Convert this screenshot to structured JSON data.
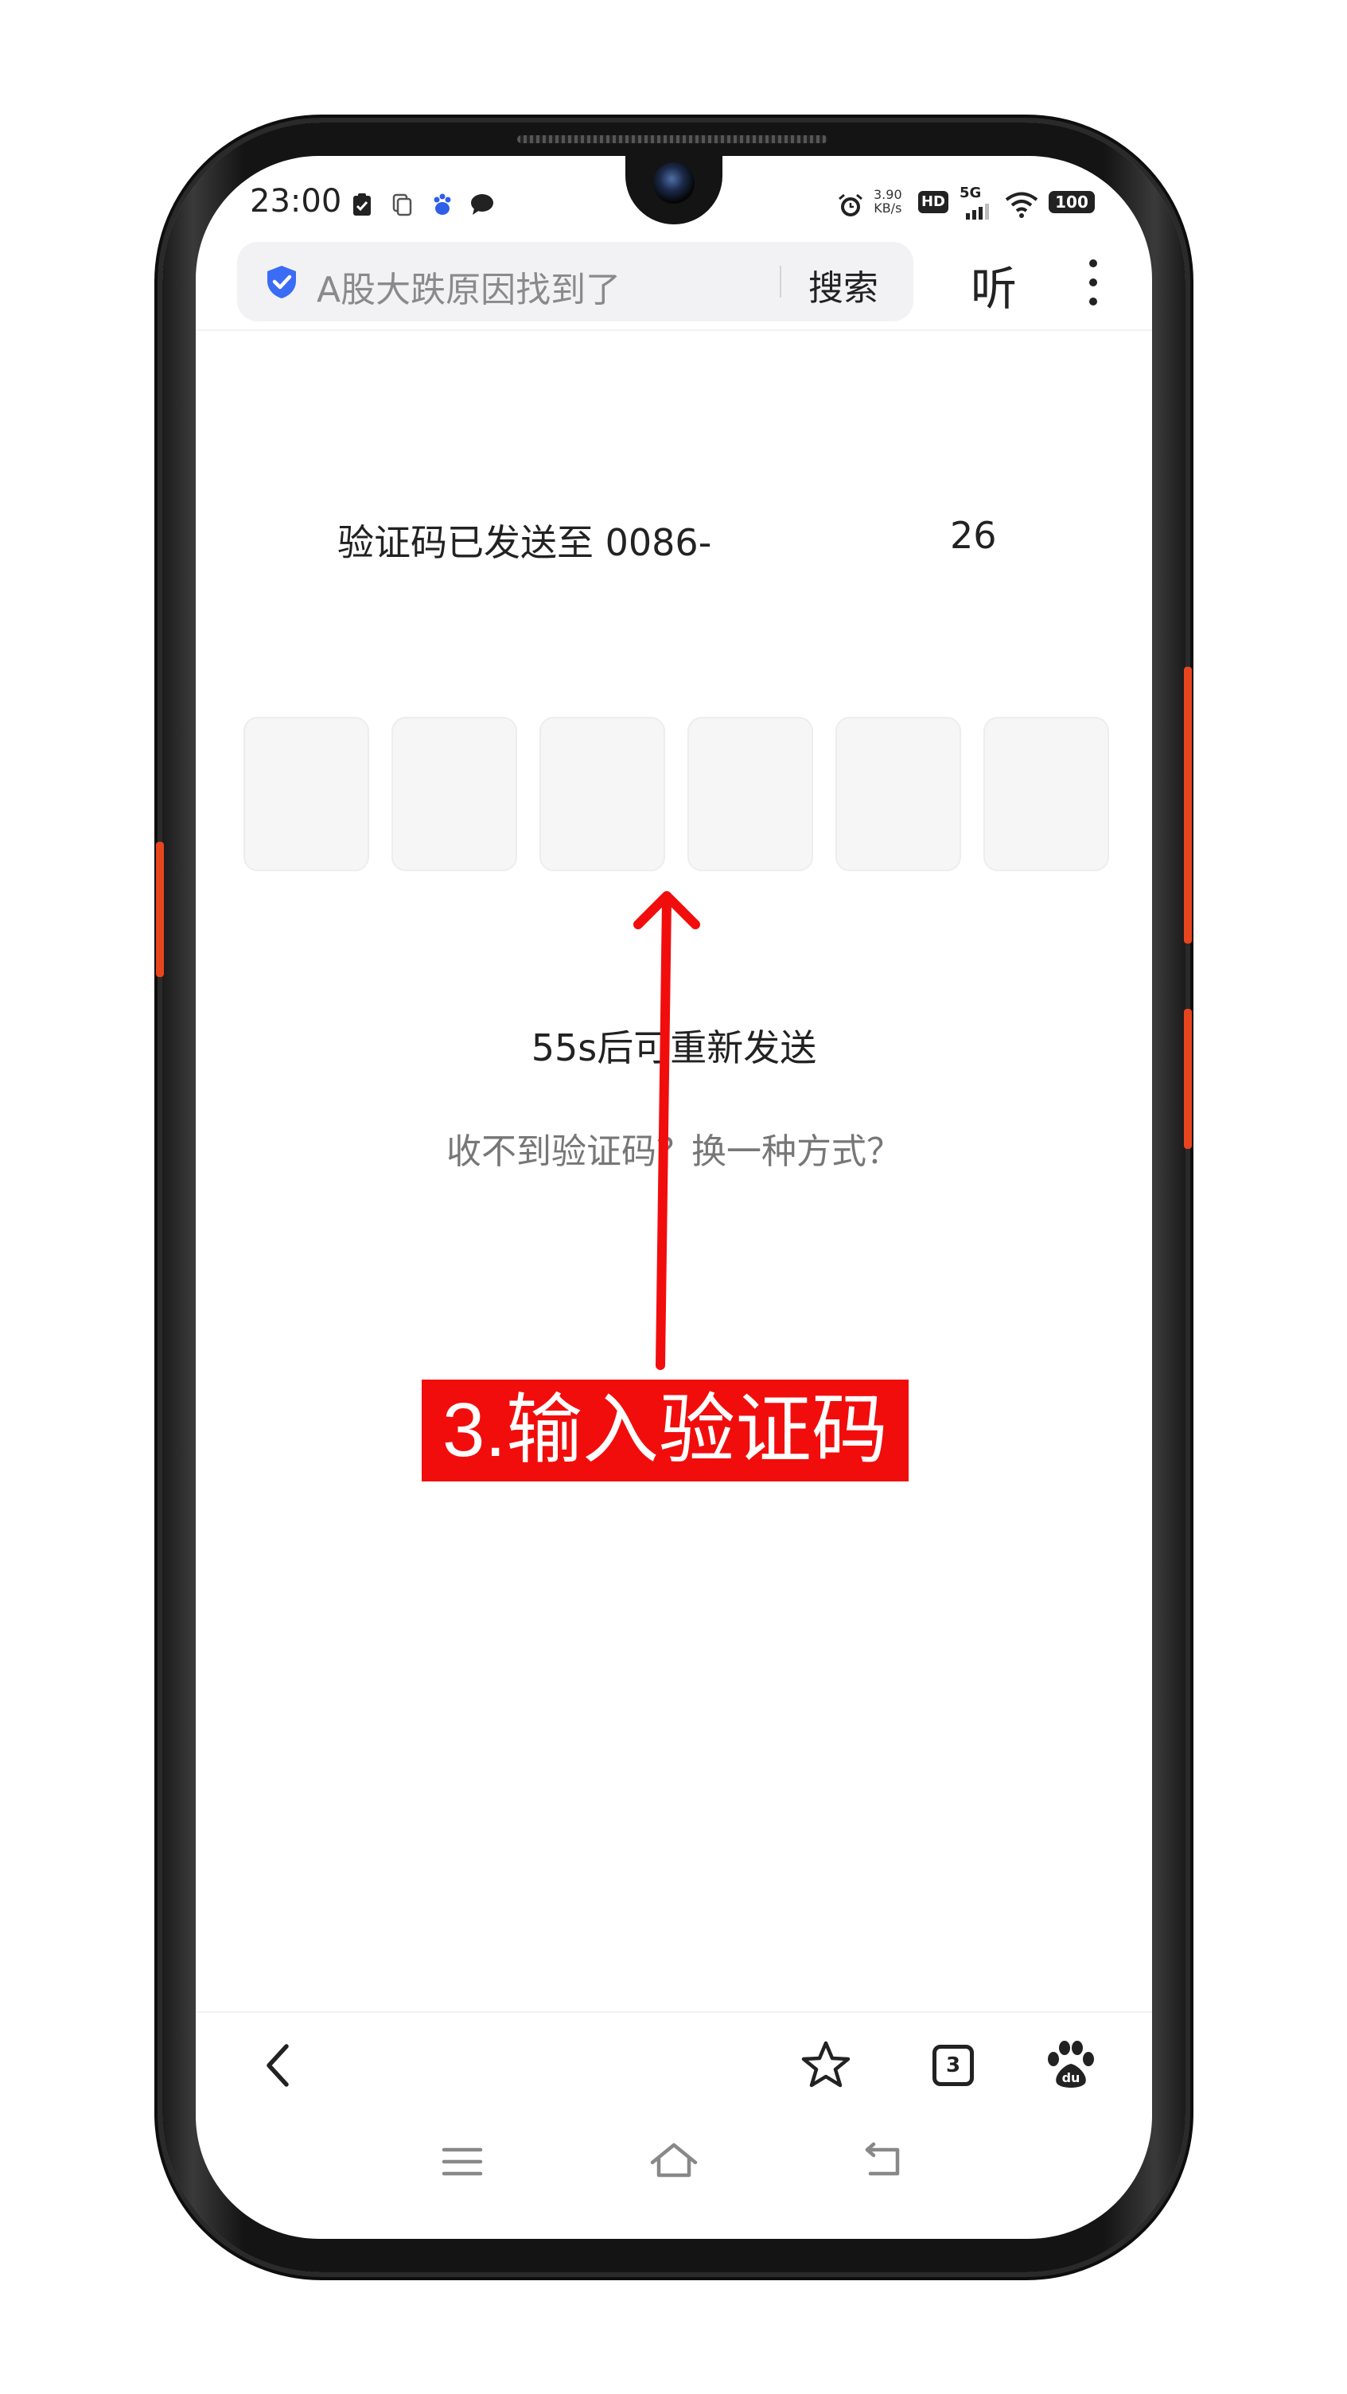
{
  "status_bar": {
    "time": "23:00",
    "net_speed_value": "3.90",
    "net_speed_unit": "KB/s",
    "hd_badge": "HD",
    "network": "5G",
    "battery": "100"
  },
  "top_bar": {
    "search_placeholder": "A股大跌原因找到了",
    "search_button": "搜索",
    "listen_button": "听"
  },
  "verification": {
    "sent_to_prefix": "验证码已发送至 0086-",
    "sent_to_suffix": "26",
    "code_length": 6,
    "resend_countdown": "55s后可重新发送",
    "alt_method_link": "收不到验证码？换一种方式？"
  },
  "annotation": {
    "step_label": "3.输入验证码",
    "color": "#f20d0d"
  },
  "bottom_bar": {
    "tab_count": "3"
  },
  "colors": {
    "accent_blue": "#3b6cf5",
    "annotation_red": "#f20d0d",
    "text_primary": "#222222",
    "text_secondary": "#777777"
  }
}
